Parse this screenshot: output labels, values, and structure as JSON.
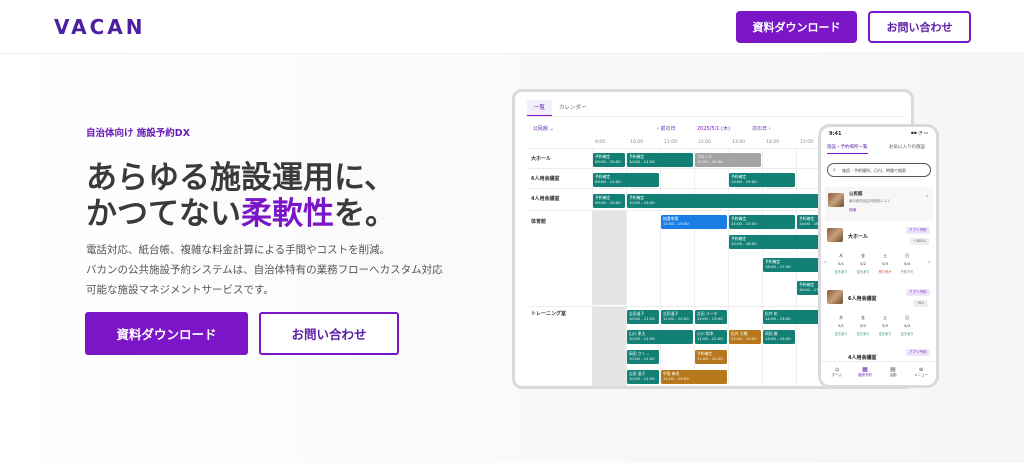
{
  "header": {
    "logo": "VACAN",
    "download_label": "資料ダウンロード",
    "contact_label": "お問い合わせ"
  },
  "hero": {
    "eyebrow": "自治体向け 施設予約DX",
    "headline_line1": "あらゆる施設運用に、",
    "headline_line2_pre": "かつてない",
    "headline_line2_accent": "柔軟性",
    "headline_line2_post": "を。",
    "desc_line1": "電話対応、紙台帳、複雑な料金計算による手間やコストを削減。",
    "desc_line2": "バカンの公共施設予約システムは、自治体特有の業務フローへカスタム対応",
    "desc_line3": "可能な施設マネジメントサービスです。",
    "cta_download": "資料ダウンロード",
    "cta_contact": "お問い合わせ"
  },
  "tablet": {
    "tabs": [
      "一覧",
      "カレンダー"
    ],
    "toolbar": {
      "facility": "公民館 ⌄",
      "prev": "‹ 前の日",
      "date": "2025/5/1 (木)",
      "next": "次の日 ›"
    },
    "times": [
      "9:00",
      "10:00",
      "11:00",
      "12:00",
      "13:00",
      "14:00",
      "15:00"
    ],
    "rows": [
      "大ホール",
      "6人用会議室",
      "4人用会議室",
      "体育館",
      "トレーニング室"
    ],
    "events": {
      "e1": "予約確定",
      "e1t": "09:00 - 10:00",
      "e2": "予約確定",
      "e2t": "10:00 - 11:00",
      "e3": "ブロック",
      "e3t": "12:00 - 13:00",
      "e4": "予約確定",
      "e4t": "09:00 - 11:00",
      "e5": "予約確定",
      "e5t": "14:00 - 15:00",
      "e6": "予約確定",
      "e6t": "09:00 - 10:00",
      "e7": "予約確定",
      "e7t": "10:00 - 15:00",
      "e8": "抽選申請",
      "e8t": "11:00 - 13:00",
      "e9": "予約確定",
      "e9t": "14:00 - 15:00",
      "e10": "予約確定",
      "e10t": "14:00 - 16:00",
      "e11": "予約確定",
      "e11t": "15:00 - 16:00",
      "e12": "予約確定",
      "e12t": "16:00 - 17:00",
      "e13": "吉田温子",
      "e13t": "10:00 - 11:00",
      "e14": "吉田温子",
      "e14t": "11:00 - 12:00",
      "e15": "吉田 ユータ",
      "e15t": "12:00 - 13:00",
      "e16": "松井 祐",
      "e16t": "14:00 - 15:00",
      "e17": "山口 恵太",
      "e17t": "10:00 - 11:00",
      "e18": "小川 知幸",
      "e18t": "11:00 - 12:00",
      "e19": "松井 大輔",
      "e19t": "12:00 - 13:00",
      "e20": "岡田 勝",
      "e20t": "14:00 - 15:00",
      "e21": "岡田 さく…",
      "e21t": "10:00 - 11:00",
      "e22": "予約確定",
      "e22t": "11:00 - 12:00",
      "e23": "吉田 温子",
      "e23t": "10:00 - 11:00",
      "e24": "中島 麻衣",
      "e24t": "11:00 - 13:00"
    }
  },
  "phone": {
    "time": "9:41",
    "status": "▪▪ ◔ ▭",
    "tab1": "施設・予約場所一覧",
    "tab2": "お気に入りの施設",
    "search_placeholder": "施設・予約場所、日付、時間で検索",
    "card_name": "公民館",
    "card_addr": "東京都渋谷区神宮前1-1-1",
    "card_link": "詳細",
    "place1": "大ホール",
    "place1_pill": "アプリ予約",
    "place1_cap": "~300人",
    "place2": "6人用会議室",
    "place2_pill": "アプリ予約",
    "place2_cap": "~6人",
    "place3": "4人用会議室",
    "place3_pill": "アプリ予約",
    "days_w": [
      "木",
      "金",
      "土",
      "日"
    ],
    "days_d": [
      "5/1",
      "5/2",
      "5/3",
      "5/4"
    ],
    "days_s": [
      "空きあり",
      "空きあり",
      "残り僅か",
      "予約不可"
    ],
    "nav": [
      "ホーム",
      "施設予約",
      "活動",
      "メニュー"
    ]
  }
}
